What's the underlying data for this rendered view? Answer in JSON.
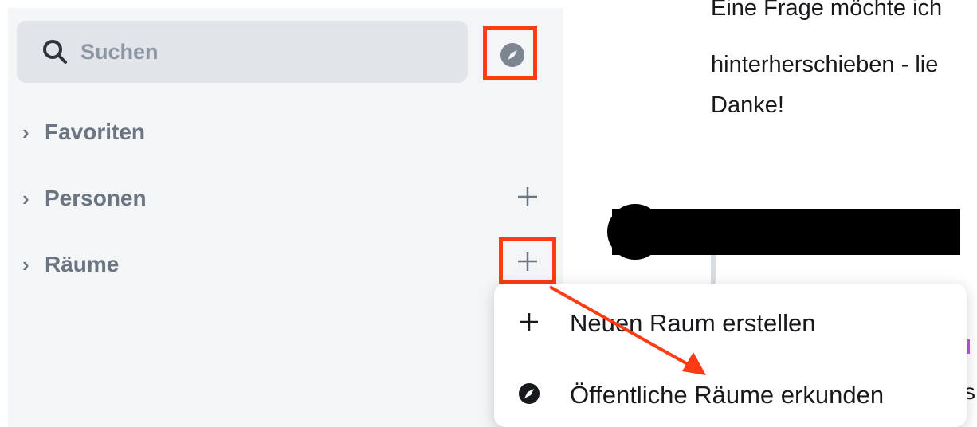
{
  "search": {
    "placeholder": "Suchen"
  },
  "sidebar": {
    "sections": [
      {
        "label": "Favoriten"
      },
      {
        "label": "Personen"
      },
      {
        "label": "Räume"
      }
    ]
  },
  "chat": {
    "lines": [
      "Eine Frage möchte ich",
      "hinterherschieben - lie",
      "Danke!"
    ],
    "peek_char": "s"
  },
  "menu": {
    "items": [
      {
        "label": "Neuen Raum erstellen",
        "icon": "plus-icon"
      },
      {
        "label": "Öffentliche Räume erkunden",
        "icon": "compass-icon"
      }
    ]
  },
  "colors": {
    "highlight": "#ff3b14",
    "sidebar_bg": "#f4f5f7",
    "search_bg": "#e1e4e8",
    "muted_text": "#6b7582"
  }
}
